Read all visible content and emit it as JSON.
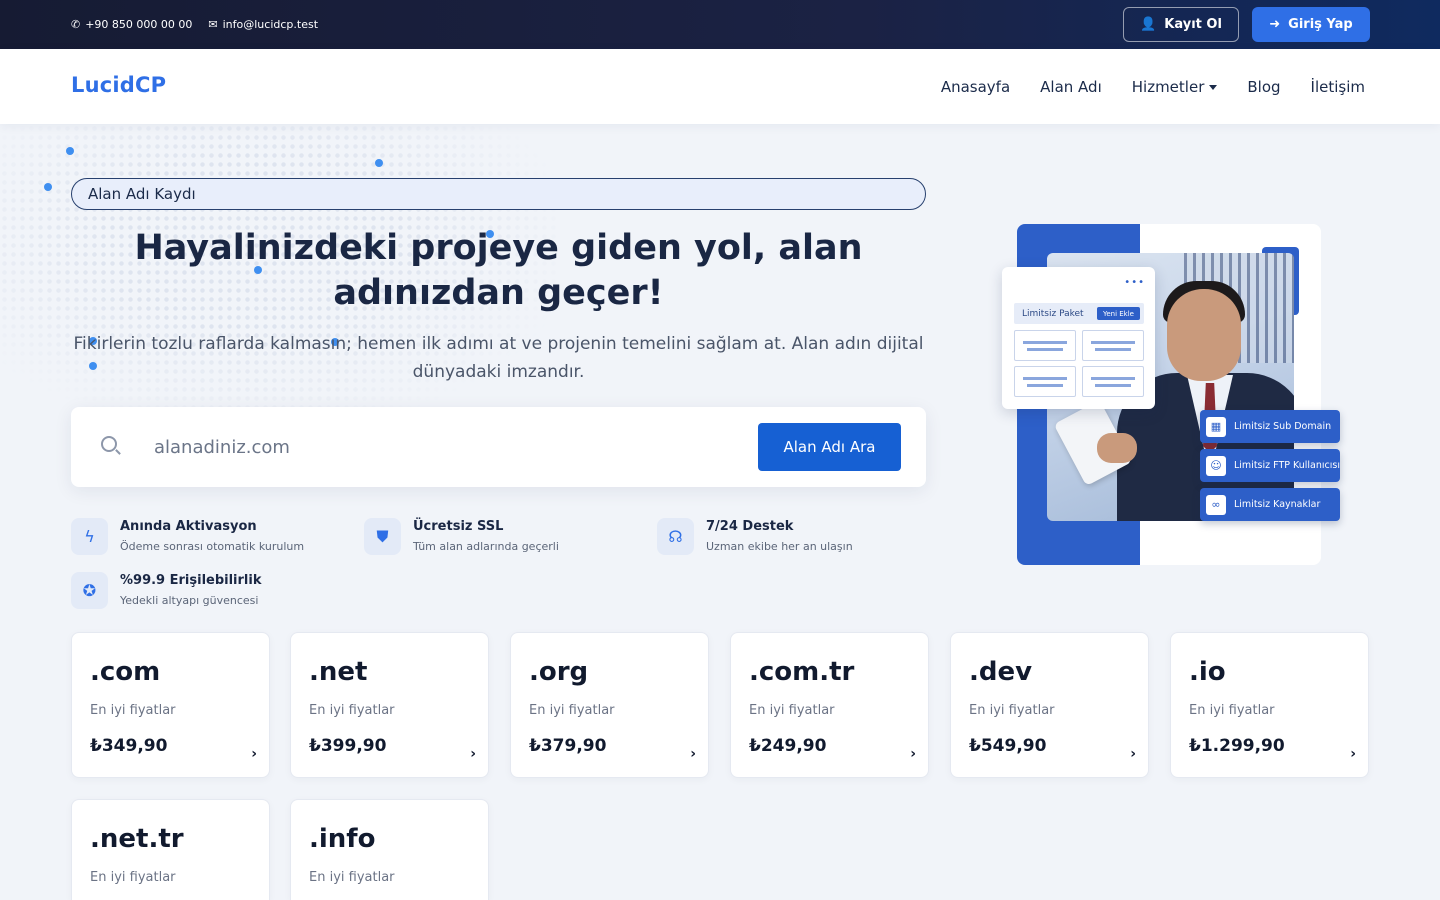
{
  "topbar": {
    "phone": "+90 850 000 00 00",
    "email": "info@lucidcp.test",
    "register_label": "Kayıt Ol",
    "login_label": "Giriş Yap"
  },
  "nav": {
    "logo": "LucidCP",
    "items": [
      "Anasayfa",
      "Alan Adı",
      "Hizmetler",
      "Blog",
      "İletişim"
    ]
  },
  "hero": {
    "badge": "Alan Adı Kaydı",
    "title": "Hayalinizdeki projeye giden yol, alan adınızdan geçer!",
    "subtitle": "Fikirlerin tozlu raflarda kalmasın; hemen ilk adımı at ve projenin temelini sağlam at. Alan adın dijital dünyadaki imzandır.",
    "search_placeholder": "alanadiniz.com",
    "search_button": "Alan Adı Ara"
  },
  "features": [
    {
      "icon": "bolt-icon",
      "title": "Anında Aktivasyon",
      "desc": "Ödeme sonrası otomatik kurulum"
    },
    {
      "icon": "shield-icon",
      "title": "Ücretsiz SSL",
      "desc": "Tüm alan adlarında geçerli"
    },
    {
      "icon": "headset-icon",
      "title": "7/24 Destek",
      "desc": "Uzman ekibe her an ulaşın"
    },
    {
      "icon": "award-icon",
      "title": "%99.9 Erişilebilirlik",
      "desc": "Yedekli altyapı güvencesi"
    }
  ],
  "illustration": {
    "panel_title": "Limitsiz Paket",
    "panel_badge": "Yeni Ekle",
    "tags": [
      "Limitsiz Sub Domain",
      "Limitsiz FTP Kullanıcısı",
      "Limitsiz Kaynaklar"
    ]
  },
  "domains": [
    {
      "tld": ".com",
      "label": "En iyi fiyatlar",
      "price": "₺349,90"
    },
    {
      "tld": ".net",
      "label": "En iyi fiyatlar",
      "price": "₺399,90"
    },
    {
      "tld": ".org",
      "label": "En iyi fiyatlar",
      "price": "₺379,90"
    },
    {
      "tld": ".com.tr",
      "label": "En iyi fiyatlar",
      "price": "₺249,90"
    },
    {
      "tld": ".dev",
      "label": "En iyi fiyatlar",
      "price": "₺549,90"
    },
    {
      "tld": ".io",
      "label": "En iyi fiyatlar",
      "price": "₺1.299,90"
    },
    {
      "tld": ".net.tr",
      "label": "En iyi fiyatlar",
      "price": ""
    },
    {
      "tld": ".info",
      "label": "En iyi fiyatlar",
      "price": ""
    }
  ],
  "colors": {
    "accent": "#2f6fe6",
    "topbar": "#161b33",
    "button": "#1660d3"
  }
}
